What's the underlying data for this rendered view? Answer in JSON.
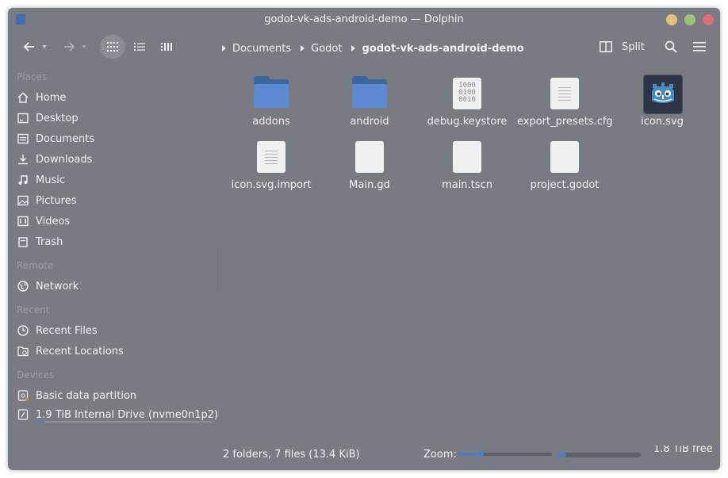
{
  "window": {
    "title": "godot-vk-ads-android-demo — Dolphin",
    "controls": [
      "minimize",
      "maximize",
      "close"
    ],
    "colors": {
      "minimize": "#e5c07b",
      "maximize": "#98c379",
      "close": "#e06c75"
    }
  },
  "toolbar": {
    "back_icon": "arrow-left-icon",
    "forward_icon": "arrow-right-icon",
    "view_modes": [
      "icons-view",
      "compact-view",
      "details-view"
    ],
    "active_view": "icons-view",
    "split_label": "Split",
    "search_icon": "search-icon",
    "menu_icon": "hamburger-menu-icon"
  },
  "breadcrumb": {
    "items": [
      "Documents",
      "Godot",
      "godot-vk-ads-android-demo"
    ]
  },
  "sidebar": {
    "places_title": "Places",
    "places": [
      {
        "label": "Home",
        "icon": "home-icon"
      },
      {
        "label": "Desktop",
        "icon": "desktop-icon"
      },
      {
        "label": "Documents",
        "icon": "document-icon"
      },
      {
        "label": "Downloads",
        "icon": "download-icon"
      },
      {
        "label": "Music",
        "icon": "music-icon"
      },
      {
        "label": "Pictures",
        "icon": "picture-icon"
      },
      {
        "label": "Videos",
        "icon": "video-icon"
      },
      {
        "label": "Trash",
        "icon": "trash-icon"
      }
    ],
    "remote_title": "Remote",
    "remote": [
      {
        "label": "Network",
        "icon": "network-icon"
      }
    ],
    "recent_title": "Recent",
    "recent": [
      {
        "label": "Recent Files",
        "icon": "clock-icon"
      },
      {
        "label": "Recent Locations",
        "icon": "folder-clock-icon"
      }
    ],
    "devices_title": "Devices",
    "devices": [
      {
        "label": "Basic data partition",
        "icon": "drive-icon"
      },
      {
        "label": "1.9 TiB Internal Drive (nvme0n1p2)",
        "icon": "drive-icon",
        "usage_fraction": 0.05
      }
    ]
  },
  "files": [
    {
      "name": "addons",
      "type": "folder"
    },
    {
      "name": "android",
      "type": "folder"
    },
    {
      "name": "debug.keystore",
      "type": "binary",
      "glyph": "1000\n0100\n0010"
    },
    {
      "name": "export_presets.cfg",
      "type": "text"
    },
    {
      "name": "icon.svg",
      "type": "godot-image"
    },
    {
      "name": "icon.svg.import",
      "type": "text"
    },
    {
      "name": "Main.gd",
      "type": "blank"
    },
    {
      "name": "main.tscn",
      "type": "blank"
    },
    {
      "name": "project.godot",
      "type": "blank"
    }
  ],
  "status": {
    "summary": "2 folders, 7 files (13.4 KiB)",
    "zoom_label": "Zoom:",
    "zoom_fraction": 0.25,
    "free_space_text": "1.8 TiB free",
    "used_fraction": 0.1,
    "accent": "#4d7fc4"
  }
}
